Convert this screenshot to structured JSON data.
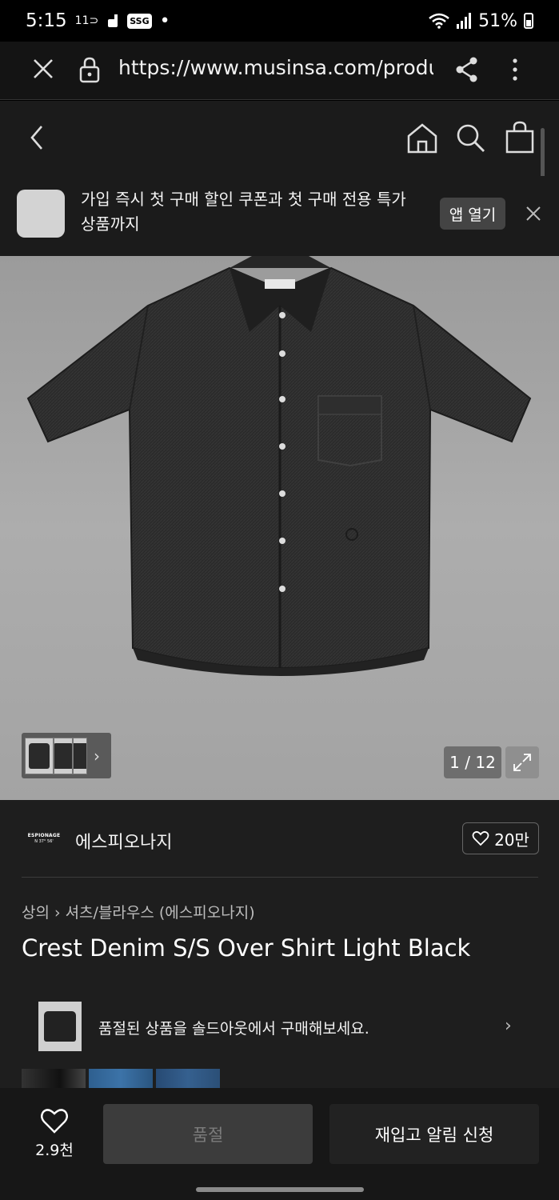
{
  "status_bar": {
    "time": "5:15",
    "carrier_badge": "11",
    "ssg_badge": "SSG",
    "dot": "•",
    "battery": "51%"
  },
  "browser": {
    "url": "https://www.musinsa.com/produ"
  },
  "app_banner": {
    "text": "가입 즉시 첫 구매 할인 쿠폰과 첫 구매 전용 특가 상품까지",
    "open_button": "앱 열기"
  },
  "gallery": {
    "page_counter": "1 / 12",
    "thumb_arrow": "›"
  },
  "brand": {
    "logo_line1": "ESPIONAGE",
    "logo_line2": "N 37° 56'",
    "name": "에스피오나지",
    "likes": "20만"
  },
  "breadcrumb": {
    "category": "상의",
    "separator": "›",
    "subcategory": "셔츠/블라우스 (에스피오나지)"
  },
  "product": {
    "title": "Crest Denim S/S Over Shirt Light Black"
  },
  "soldout_banner": {
    "text": "품절된 상품을 솔드아웃에서 구매해보세요.",
    "arrow": "›"
  },
  "bottom_bar": {
    "wish_count": "2.9천",
    "soldout_button": "품절",
    "restock_button": "재입고 알림 신청"
  },
  "colors": {
    "background": "#1e1e1e",
    "image_bg": "#a8a8a8",
    "disabled_button": "#3c3c3c"
  }
}
